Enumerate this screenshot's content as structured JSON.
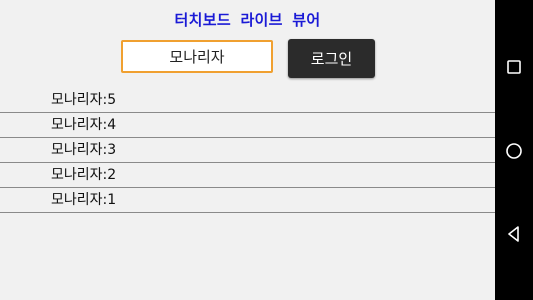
{
  "header": {
    "title": "터치보드 라이브 뷰어"
  },
  "login": {
    "username": "모나리자",
    "button_label": "로그인"
  },
  "list": {
    "items": [
      {
        "label": "모나리자:5"
      },
      {
        "label": "모나리자:4"
      },
      {
        "label": "모나리자:3"
      },
      {
        "label": "모나리자:2"
      },
      {
        "label": "모나리자:1"
      }
    ]
  },
  "navbar": {
    "buttons": [
      "recents-square-icon",
      "home-circle-icon",
      "back-triangle-icon"
    ]
  },
  "colors": {
    "title": "#1a1ad6",
    "input_border": "#f0a030",
    "button_bg": "#2b2b2b",
    "navbar_bg": "#000000"
  }
}
